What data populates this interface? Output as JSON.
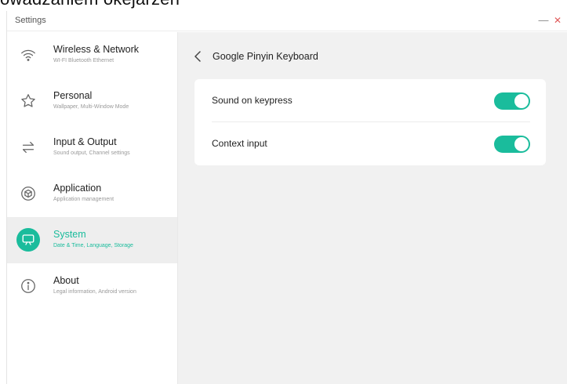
{
  "overlay_text": "owadzaniem okejarzeń",
  "window": {
    "title": "Settings",
    "minimize_glyph": "—",
    "close_glyph": "✕"
  },
  "sidebar": {
    "items": [
      {
        "label": "Wireless & Network",
        "sub": "WI-FI Bluetooth Ethernet",
        "icon": "wifi-icon",
        "active": false
      },
      {
        "label": "Personal",
        "sub": "Wallpaper, Multi-Window Mode",
        "icon": "star-icon",
        "active": false
      },
      {
        "label": "Input & Output",
        "sub": "Sound output, Channel settings",
        "icon": "swap-arrows-icon",
        "active": false
      },
      {
        "label": "Application",
        "sub": "Application management",
        "icon": "cube-icon",
        "active": false
      },
      {
        "label": "System",
        "sub": "Date & Time, Language, Storage",
        "icon": "monitor-icon",
        "active": true
      },
      {
        "label": "About",
        "sub": "Legal information, Android version",
        "icon": "info-icon",
        "active": false
      }
    ]
  },
  "main": {
    "back_icon": "chevron-left-icon",
    "title": "Google Pinyin Keyboard",
    "settings": [
      {
        "label": "Sound on keypress",
        "enabled": true
      },
      {
        "label": "Context input",
        "enabled": true
      }
    ]
  },
  "colors": {
    "accent": "#1abc9c",
    "active_bg": "#eeeeee",
    "content_bg": "#f1f1f1",
    "close": "#e05a5a"
  }
}
